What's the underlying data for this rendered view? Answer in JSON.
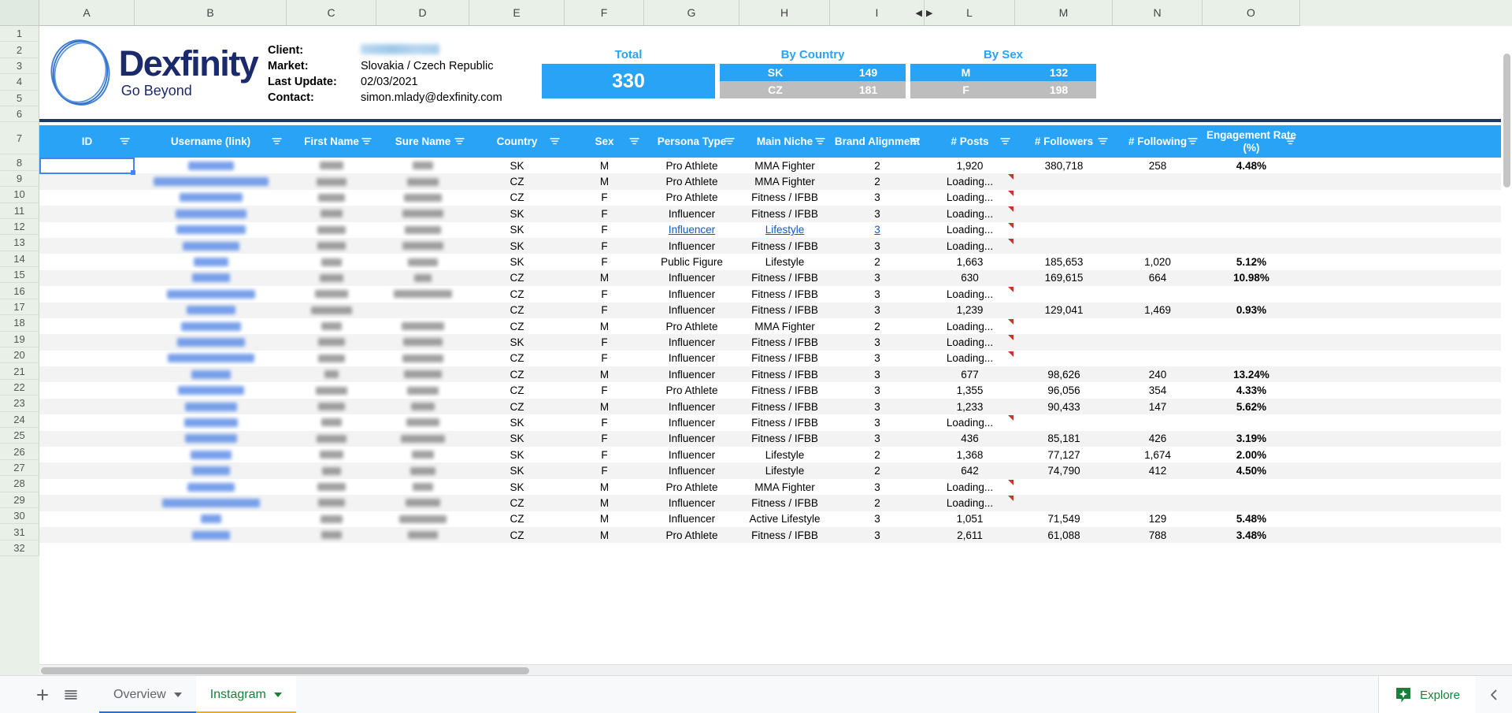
{
  "columns": {
    "letters": [
      "A",
      "B",
      "C",
      "D",
      "E",
      "F",
      "G",
      "H",
      "I",
      "L",
      "M",
      "N",
      "O"
    ],
    "hidden_marker": {
      "left_arrow": "◀",
      "right_arrow": "▶"
    }
  },
  "row_numbers": [
    "1",
    "2",
    "3",
    "4",
    "5",
    "6",
    "7",
    "8",
    "9",
    "10",
    "11",
    "12",
    "13",
    "14",
    "15",
    "16",
    "17",
    "18",
    "19",
    "20",
    "21",
    "22",
    "23",
    "24",
    "25",
    "26",
    "27",
    "28",
    "29",
    "30",
    "31",
    "32"
  ],
  "brand": {
    "name": "Dexfinity",
    "tagline": "Go Beyond",
    "logo_icon": "scribble-circle-logo"
  },
  "info": {
    "rows": [
      {
        "label": "Client:",
        "value": "",
        "redacted": true
      },
      {
        "label": "Market:",
        "value": "Slovakia / Czech Republic",
        "redacted": false
      },
      {
        "label": "Last Update:",
        "value": "02/03/2021",
        "redacted": false
      },
      {
        "label": "Contact:",
        "value": "simon.mlady@dexfinity.com",
        "redacted": false
      }
    ]
  },
  "stats": {
    "total": {
      "caption": "Total",
      "value": "330"
    },
    "by_country": {
      "caption": "By Country",
      "rows": [
        {
          "key": "SK",
          "value": "149"
        },
        {
          "key": "CZ",
          "value": "181"
        }
      ]
    },
    "by_sex": {
      "caption": "By Sex",
      "rows": [
        {
          "key": "M",
          "value": "132"
        },
        {
          "key": "F",
          "value": "198"
        }
      ]
    }
  },
  "colors": {
    "accent_blue": "#29a3f5",
    "gray_row": "#bdbdbd",
    "navy": "#1f3864",
    "link": "#1155cc",
    "green": "#188038",
    "orange": "#f9ab00"
  },
  "table": {
    "headers": [
      "ID",
      "Username (link)",
      "First Name",
      "Sure Name",
      "Country",
      "Sex",
      "Persona Type",
      "Main Niche",
      "Brand Alignment",
      "# Posts",
      "# Followers",
      "# Following",
      "Engagement Rate (%)"
    ],
    "loading_text": "Loading...",
    "rows": [
      {
        "row": "8",
        "username_w": 58,
        "first_w": 30,
        "sure_w": 26,
        "country": "SK",
        "sex": "M",
        "persona": "Pro Athlete",
        "niche": "MMA Fighter",
        "brand": "2",
        "posts": "1,920",
        "followers": "380,718",
        "following": "258",
        "engagement": "4.48%",
        "note": false,
        "link_style": false
      },
      {
        "row": "9",
        "username_w": 146,
        "first_w": 38,
        "sure_w": 40,
        "country": "CZ",
        "sex": "M",
        "persona": "Pro Athlete",
        "niche": "MMA Fighter",
        "brand": "2",
        "posts": "Loading...",
        "followers": "",
        "following": "",
        "engagement": "",
        "note": true,
        "link_style": false
      },
      {
        "row": "10",
        "username_w": 80,
        "first_w": 34,
        "sure_w": 48,
        "country": "CZ",
        "sex": "F",
        "persona": "Pro Athlete",
        "niche": "Fitness / IFBB",
        "brand": "3",
        "posts": "Loading...",
        "followers": "",
        "following": "",
        "engagement": "",
        "note": true,
        "link_style": false
      },
      {
        "row": "11",
        "username_w": 90,
        "first_w": 28,
        "sure_w": 52,
        "country": "SK",
        "sex": "F",
        "persona": "Influencer",
        "niche": "Fitness / IFBB",
        "brand": "3",
        "posts": "Loading...",
        "followers": "",
        "following": "",
        "engagement": "",
        "note": true,
        "link_style": false
      },
      {
        "row": "12",
        "username_w": 88,
        "first_w": 36,
        "sure_w": 46,
        "country": "SK",
        "sex": "F",
        "persona": "Influencer",
        "niche": "Lifestyle ",
        "brand": "3",
        "posts": "Loading...",
        "followers": "",
        "following": "",
        "engagement": "",
        "note": true,
        "link_style": true
      },
      {
        "row": "13",
        "username_w": 72,
        "first_w": 36,
        "sure_w": 52,
        "country": "SK",
        "sex": "F",
        "persona": "Influencer",
        "niche": "Fitness / IFBB",
        "brand": "3",
        "posts": "Loading...",
        "followers": "",
        "following": "",
        "engagement": "",
        "note": true,
        "link_style": false
      },
      {
        "row": "14",
        "username_w": 44,
        "first_w": 26,
        "sure_w": 38,
        "country": "SK",
        "sex": "F",
        "persona": "Public Figure",
        "niche": "Lifestyle",
        "brand": "2",
        "posts": "1,663",
        "followers": "185,653",
        "following": "1,020",
        "engagement": "5.12%",
        "note": false,
        "link_style": false
      },
      {
        "row": "15",
        "username_w": 48,
        "first_w": 30,
        "sure_w": 22,
        "country": "CZ",
        "sex": "M",
        "persona": "Influencer",
        "niche": "Fitness / IFBB",
        "brand": "3",
        "posts": "630",
        "followers": "169,615",
        "following": "664",
        "engagement": "10.98%",
        "note": false,
        "link_style": false
      },
      {
        "row": "16",
        "username_w": 112,
        "first_w": 42,
        "sure_w": 74,
        "country": "CZ",
        "sex": "F",
        "persona": "Influencer",
        "niche": "Fitness / IFBB",
        "brand": "3",
        "posts": "Loading...",
        "followers": "",
        "following": "",
        "engagement": "",
        "note": true,
        "link_style": false
      },
      {
        "row": "17",
        "username_w": 62,
        "first_w": 52,
        "sure_w": 0,
        "country": "CZ",
        "sex": "F",
        "persona": "Influencer",
        "niche": "Fitness / IFBB",
        "brand": "3",
        "posts": "1,239",
        "followers": "129,041",
        "following": "1,469",
        "engagement": "0.93%",
        "note": false,
        "link_style": false
      },
      {
        "row": "18",
        "username_w": 76,
        "first_w": 26,
        "sure_w": 54,
        "country": "CZ",
        "sex": "M",
        "persona": "Pro Athlete",
        "niche": "MMA Fighter",
        "brand": "2",
        "posts": "Loading...",
        "followers": "",
        "following": "",
        "engagement": "",
        "note": true,
        "link_style": false
      },
      {
        "row": "19",
        "username_w": 86,
        "first_w": 34,
        "sure_w": 50,
        "country": "SK",
        "sex": "F",
        "persona": "Influencer",
        "niche": "Fitness / IFBB",
        "brand": "3",
        "posts": "Loading...",
        "followers": "",
        "following": "",
        "engagement": "",
        "note": true,
        "link_style": false
      },
      {
        "row": "20",
        "username_w": 110,
        "first_w": 34,
        "sure_w": 52,
        "country": "CZ",
        "sex": "F",
        "persona": "Influencer",
        "niche": "Fitness / IFBB",
        "brand": "3",
        "posts": "Loading...",
        "followers": "",
        "following": "",
        "engagement": "",
        "note": true,
        "link_style": false
      },
      {
        "row": "21",
        "username_w": 50,
        "first_w": 18,
        "sure_w": 48,
        "country": "CZ",
        "sex": "M",
        "persona": "Influencer",
        "niche": "Fitness / IFBB",
        "brand": "3",
        "posts": "677",
        "followers": "98,626",
        "following": "240",
        "engagement": "13.24%",
        "note": false,
        "link_style": false
      },
      {
        "row": "22",
        "username_w": 84,
        "first_w": 40,
        "sure_w": 40,
        "country": "CZ",
        "sex": "F",
        "persona": "Pro Athlete",
        "niche": "Fitness / IFBB",
        "brand": "3",
        "posts": "1,355",
        "followers": "96,056",
        "following": "354",
        "engagement": "4.33%",
        "note": false,
        "link_style": false
      },
      {
        "row": "23",
        "username_w": 66,
        "first_w": 34,
        "sure_w": 30,
        "country": "CZ",
        "sex": "M",
        "persona": "Influencer",
        "niche": "Fitness / IFBB",
        "brand": "3",
        "posts": "1,233",
        "followers": "90,433",
        "following": "147",
        "engagement": "5.62%",
        "note": false,
        "link_style": false
      },
      {
        "row": "24",
        "username_w": 68,
        "first_w": 26,
        "sure_w": 42,
        "country": "SK",
        "sex": "F",
        "persona": "Influencer",
        "niche": "Fitness / IFBB",
        "brand": "3",
        "posts": "Loading...",
        "followers": "",
        "following": "",
        "engagement": "",
        "note": true,
        "link_style": false
      },
      {
        "row": "25",
        "username_w": 66,
        "first_w": 38,
        "sure_w": 56,
        "country": "SK",
        "sex": "F",
        "persona": "Influencer",
        "niche": "Fitness / IFBB",
        "brand": "3",
        "posts": "436",
        "followers": "85,181",
        "following": "426",
        "engagement": "3.19%",
        "note": false,
        "link_style": false
      },
      {
        "row": "26",
        "username_w": 52,
        "first_w": 30,
        "sure_w": 28,
        "country": "SK",
        "sex": "F",
        "persona": "Influencer",
        "niche": "Lifestyle",
        "brand": "2",
        "posts": "1,368",
        "followers": "77,127",
        "following": "1,674",
        "engagement": "2.00%",
        "note": false,
        "link_style": false
      },
      {
        "row": "27",
        "username_w": 48,
        "first_w": 24,
        "sure_w": 32,
        "country": "SK",
        "sex": "F",
        "persona": "Influencer",
        "niche": "Lifestyle",
        "brand": "2",
        "posts": "642",
        "followers": "74,790",
        "following": "412",
        "engagement": "4.50%",
        "note": false,
        "link_style": false
      },
      {
        "row": "28",
        "username_w": 60,
        "first_w": 36,
        "sure_w": 26,
        "country": "SK",
        "sex": "M",
        "persona": "Pro Athlete",
        "niche": "MMA Fighter",
        "brand": "3",
        "posts": "Loading...",
        "followers": "",
        "following": "",
        "engagement": "",
        "note": true,
        "link_style": false
      },
      {
        "row": "29",
        "username_w": 124,
        "first_w": 34,
        "sure_w": 44,
        "country": "CZ",
        "sex": "M",
        "persona": "Influencer",
        "niche": "Fitness / IFBB",
        "brand": "2",
        "posts": "Loading...",
        "followers": "",
        "following": "",
        "engagement": "",
        "note": true,
        "link_style": false
      },
      {
        "row": "30",
        "username_w": 26,
        "first_w": 28,
        "sure_w": 60,
        "country": "CZ",
        "sex": "M",
        "persona": "Influencer",
        "niche": "Active Lifestyle",
        "brand": "3",
        "posts": "1,051",
        "followers": "71,549",
        "following": "129",
        "engagement": "5.48%",
        "note": false,
        "link_style": false
      },
      {
        "row": "31",
        "username_w": 48,
        "first_w": 26,
        "sure_w": 38,
        "country": "CZ",
        "sex": "M",
        "persona": "Pro Athlete",
        "niche": "Fitness / IFBB",
        "brand": "3",
        "posts": "2,611",
        "followers": "61,088",
        "following": "788",
        "engagement": "3.48%",
        "note": false,
        "link_style": false
      }
    ]
  },
  "bottom_bar": {
    "add_sheet_icon": "plus-icon",
    "all_sheets_icon": "hamburger-list-icon",
    "tabs": [
      {
        "label": "Overview",
        "active": false,
        "underline": "#1a73e8"
      },
      {
        "label": "Instagram",
        "active": true,
        "underline": "#f9ab00"
      }
    ],
    "explore_label": "Explore",
    "explore_icon": "explore-star-icon",
    "collapse_icon": "chevron-left-icon"
  }
}
